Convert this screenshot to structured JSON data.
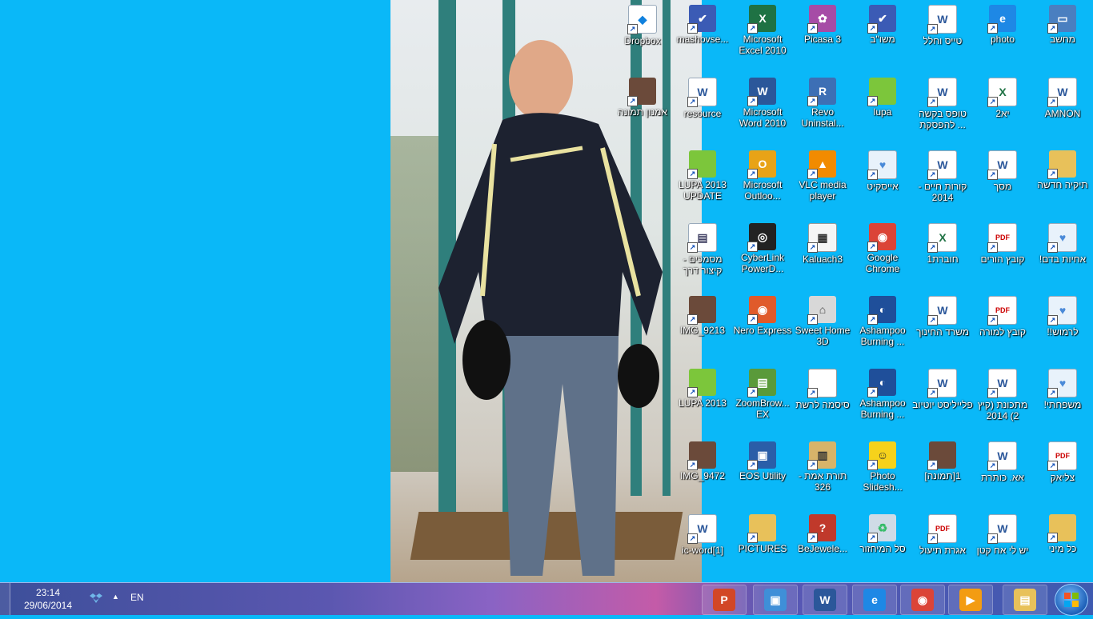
{
  "desktop": {
    "columns": [
      [
        {
          "label": "מחשב",
          "icon": "computer-icon"
        },
        {
          "label": "AMNON",
          "icon": "word-doc-icon"
        },
        {
          "label": "תיקיה חדשה",
          "icon": "folder-icon"
        },
        {
          "label": "!אחיות בדם",
          "icon": "image-file-icon"
        },
        {
          "label": "!!לרמוש",
          "icon": "image-file-icon"
        },
        {
          "label": "!משפחתי",
          "icon": "image-file-icon"
        },
        {
          "label": "צליאק",
          "icon": "pdf-icon"
        },
        {
          "label": "כל מיני",
          "icon": "folder-icon"
        }
      ],
      [
        {
          "label": "photo",
          "icon": "internet-explorer-icon"
        },
        {
          "label": "יא2",
          "icon": "excel-doc-icon"
        },
        {
          "label": "מסך",
          "icon": "word-doc-icon"
        },
        {
          "label": "קובץ הורים",
          "icon": "pdf-icon"
        },
        {
          "label": "קובץ למורה",
          "icon": "pdf-icon"
        },
        {
          "label": "מתכונת (קיץ 2) 2014",
          "icon": "word-doc-icon"
        },
        {
          "label": "אא. כותרת",
          "icon": "word-doc-icon"
        },
        {
          "label": "יש לי אח קטן",
          "icon": "word-doc-icon"
        }
      ],
      [
        {
          "label": "טייס וחלל",
          "icon": "word-doc-icon"
        },
        {
          "label": "טופס בקשה להפסקת ...",
          "icon": "word-doc-icon"
        },
        {
          "label": "קורות חיים - 2014",
          "icon": "word-doc-icon"
        },
        {
          "label": "חוברת1",
          "icon": "excel-doc-icon"
        },
        {
          "label": "משרד החינוך",
          "icon": "word-doc-icon"
        },
        {
          "label": "פלייליסט יוטיוב",
          "icon": "word-doc-icon"
        },
        {
          "label": "[תמונה]1",
          "icon": "photo-thumb-icon"
        },
        {
          "label": "אגרת תיעול",
          "icon": "pdf-icon"
        }
      ],
      [
        {
          "label": "משו\"ב",
          "icon": "mashov-icon"
        },
        {
          "label": "lupa",
          "icon": "lupa-icon"
        },
        {
          "label": "אייסקיט",
          "icon": "image-file-icon"
        },
        {
          "label": "Google Chrome",
          "icon": "chrome-icon"
        },
        {
          "label": "Ashampoo Burning ...",
          "icon": "ashampoo-icon"
        },
        {
          "label": "Ashampoo Burning ...",
          "icon": "ashampoo-icon"
        },
        {
          "label": "Photo Slidesh...",
          "icon": "smiley-icon"
        },
        {
          "label": "סל המיחזור",
          "icon": "recycle-bin-icon"
        }
      ],
      [
        {
          "label": "Picasa 3",
          "icon": "picasa-icon"
        },
        {
          "label": "Revo Uninstal...",
          "icon": "revo-icon"
        },
        {
          "label": "VLC media player",
          "icon": "vlc-icon"
        },
        {
          "label": "Kaluach3",
          "icon": "calendar-icon"
        },
        {
          "label": "Sweet Home 3D",
          "icon": "house-icon"
        },
        {
          "label": "סיסמה לרשת",
          "icon": "blank-doc-icon"
        },
        {
          "label": "תורת אמת - 326",
          "icon": "book-icon"
        },
        {
          "label": "BeJewele...",
          "icon": "help-icon"
        }
      ],
      [
        {
          "label": "Microsoft Excel 2010",
          "icon": "excel-app-icon"
        },
        {
          "label": "Microsoft Word 2010",
          "icon": "word-app-icon"
        },
        {
          "label": "Microsoft Outloo...",
          "icon": "outlook-icon"
        },
        {
          "label": "CyberLink PowerD...",
          "icon": "cyberlink-icon"
        },
        {
          "label": "Nero Express",
          "icon": "nero-icon"
        },
        {
          "label": "ZoomBrow... EX",
          "icon": "zoombrowser-icon"
        },
        {
          "label": "EOS Utility",
          "icon": "eos-icon"
        },
        {
          "label": "PICTURES",
          "icon": "folder-icon"
        }
      ],
      [
        {
          "label": "mashovse...",
          "icon": "mashov-icon"
        },
        {
          "label": "resource",
          "icon": "word-doc-icon"
        },
        {
          "label": "LUPA 2013 UPDATE",
          "icon": "lupa-icon"
        },
        {
          "label": "מסמכים - קיצור דרך",
          "icon": "documents-icon"
        },
        {
          "label": "IMG_9213",
          "icon": "photo-thumb-icon"
        },
        {
          "label": "LUPA 2013",
          "icon": "lupa-icon"
        },
        {
          "label": "IMG_9472",
          "icon": "photo-thumb-icon"
        },
        {
          "label": "ic-word[1]",
          "icon": "word-doc-icon"
        }
      ],
      [
        {
          "label": "Dropbox",
          "icon": "dropbox-icon"
        },
        {
          "label": "אמנון תמונה",
          "icon": "photo-thumb-icon"
        }
      ]
    ]
  },
  "taskbar": {
    "time": "23:14",
    "date": "29/06/2014",
    "language": "EN",
    "tray_arrow": "▲",
    "pinned": [
      {
        "name": "powerpoint",
        "icon": "powerpoint-icon",
        "glyph": "P",
        "color": "#d24726"
      },
      {
        "name": "photo-viewer",
        "icon": "photo-viewer-icon",
        "glyph": "▣",
        "color": "#3f8fd8"
      },
      {
        "name": "word",
        "icon": "word-icon",
        "glyph": "W",
        "color": "#2b579a"
      },
      {
        "name": "internet-explorer",
        "icon": "internet-explorer-icon",
        "glyph": "e",
        "color": "#1e88e5"
      },
      {
        "name": "chrome",
        "icon": "chrome-icon",
        "glyph": "◉",
        "color": "#db4437"
      },
      {
        "name": "media-player",
        "icon": "media-player-icon",
        "glyph": "▶",
        "color": "#f39c12"
      },
      {
        "name": "explorer",
        "icon": "file-explorer-icon",
        "glyph": "▤",
        "color": "#e8c15a"
      }
    ]
  }
}
